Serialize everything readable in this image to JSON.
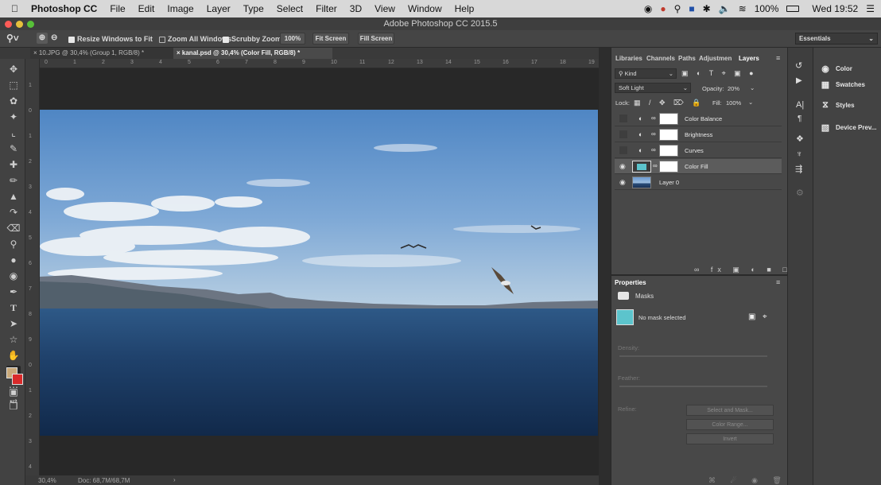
{
  "menubar": {
    "apple": "",
    "app_name": "Photoshop CC",
    "items": [
      "File",
      "Edit",
      "Image",
      "Layer",
      "Type",
      "Select",
      "Filter",
      "3D",
      "View",
      "Window",
      "Help"
    ],
    "battery": "100%",
    "clock": "Wed 19:52"
  },
  "window": {
    "title": "Adobe Photoshop CC 2015.5"
  },
  "options": {
    "resize_windows": "Resize Windows to Fit",
    "zoom_all": "Zoom All Windows",
    "scrubby": "Scrubby Zoom",
    "zoom_pct": "100%",
    "fit_screen": "Fit Screen",
    "fill_screen": "Fill Screen",
    "workspace": "Essentials"
  },
  "tabs": [
    {
      "label": "10.JPG @ 30,4% (Group 1, RGB/8) *"
    },
    {
      "label": "kanal.psd @ 30,4% (Color Fill, RGB/8) *"
    }
  ],
  "ruler_h_ticks": [
    "0",
    "1",
    "2",
    "3",
    "4",
    "5",
    "6",
    "7",
    "8",
    "9",
    "10",
    "11",
    "12",
    "13",
    "14",
    "15",
    "16",
    "17",
    "18",
    "19"
  ],
  "ruler_v_ticks": [
    "1",
    "0",
    "1",
    "2",
    "3",
    "4",
    "5",
    "6",
    "7",
    "8",
    "9",
    "0",
    "1",
    "2",
    "3",
    "4"
  ],
  "status": {
    "zoom": "30,4%",
    "doc": "Doc: 68,7M/68,7M"
  },
  "panel_tabs": [
    "Libraries",
    "Channels",
    "Paths",
    "Adjustmen",
    "Layers"
  ],
  "layers": {
    "filter_kind": "Kind",
    "blend_mode": "Soft Light",
    "opacity_label": "Opacity:",
    "opacity_value": "20%",
    "lock_label": "Lock:",
    "fill_label": "Fill:",
    "fill_value": "100%",
    "items": [
      {
        "name": "Color Balance",
        "visible": false
      },
      {
        "name": "Brightness",
        "visible": false
      },
      {
        "name": "Curves",
        "visible": false
      },
      {
        "name": "Color Fill",
        "visible": true
      },
      {
        "name": "Layer 0",
        "visible": true
      }
    ]
  },
  "properties": {
    "title": "Properties",
    "section": "Masks",
    "no_mask": "No mask selected",
    "density": "Density:",
    "feather": "Feather:",
    "refine": "Refine:",
    "select_mask": "Select and Mask...",
    "color_range": "Color Range...",
    "invert": "Invert"
  },
  "library_panel": {
    "items": [
      {
        "label": "Color",
        "icon": "color-icon"
      },
      {
        "label": "Swatches",
        "icon": "swatches-icon"
      },
      {
        "label": "Styles",
        "icon": "styles-icon"
      },
      {
        "label": "Device Prev...",
        "icon": "device-preview-icon"
      }
    ]
  },
  "colors": {
    "fill_color": "#5cc4cc",
    "foreground": "#c9a97a",
    "background": "#d92a2a"
  }
}
